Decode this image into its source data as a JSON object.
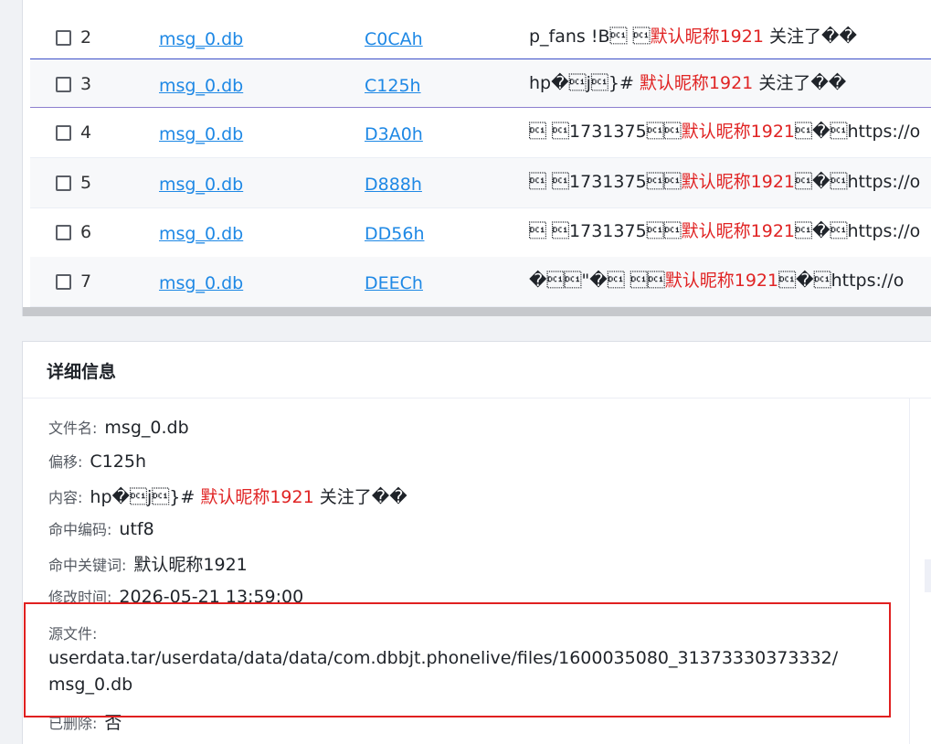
{
  "results": {
    "rows": [
      {
        "idx": "2",
        "file": "msg_0.db",
        "offset": "C0CAh",
        "pre": "p_fans !B\u0011 \u0011",
        "kw": "默认昵称1921",
        "post": " 关注了��"
      },
      {
        "idx": "3",
        "file": "msg_0.db",
        "offset": "C125h",
        "pre": "hp�\u0011j\u0011}# ",
        "kw": "默认昵称1921",
        "post": " 关注了��"
      },
      {
        "idx": "4",
        "file": "msg_0.db",
        "offset": "D3A0h",
        "pre": "\u0011 \u00111731375\u0011\u0011",
        "kw": "默认昵称1921",
        "post": "\u0011�\u0011https://o"
      },
      {
        "idx": "5",
        "file": "msg_0.db",
        "offset": "D888h",
        "pre": "\u0011 \u00111731375\u0011\u0011",
        "kw": "默认昵称1921",
        "post": "\u0011�\u0011https://o"
      },
      {
        "idx": "6",
        "file": "msg_0.db",
        "offset": "DD56h",
        "pre": "\u0011 \u00111731375\u0011\u0011",
        "kw": "默认昵称1921",
        "post": "\u0011�\u0011https://o"
      },
      {
        "idx": "7",
        "file": "msg_0.db",
        "offset": "DEECh",
        "pre": "�\u0011\u0011\"�\u0011 \u0011\u0011",
        "kw": "默认昵称1921",
        "post": "\u0011�\u0011https://o"
      }
    ]
  },
  "detail": {
    "title": "详细信息",
    "filename_label": "文件名:",
    "filename": "msg_0.db",
    "offset_label": "偏移:",
    "offset": "C125h",
    "content_label": "内容:",
    "content_pre": "hp�\u0011j\u0011}# ",
    "content_kw": "默认昵称1921",
    "content_post": " 关注了��",
    "encoding_label": "命中编码:",
    "encoding": "utf8",
    "keyword_label": "命中关键词:",
    "keyword": "默认昵称1921",
    "mtime_label": "修改时间:",
    "mtime": "2026-05-21 13:59:00",
    "source_label": "源文件:",
    "source_line1": "userdata.tar/userdata/data/data/com.dbbjt.phonelive/files/1600035080_31373330373332/",
    "source_line2": "msg_0.db",
    "deleted_label": "已删除:",
    "deleted": "否"
  },
  "colors": {
    "link": "#1e88e5",
    "keyword": "#e02424",
    "highlight_box": "#e02020"
  }
}
